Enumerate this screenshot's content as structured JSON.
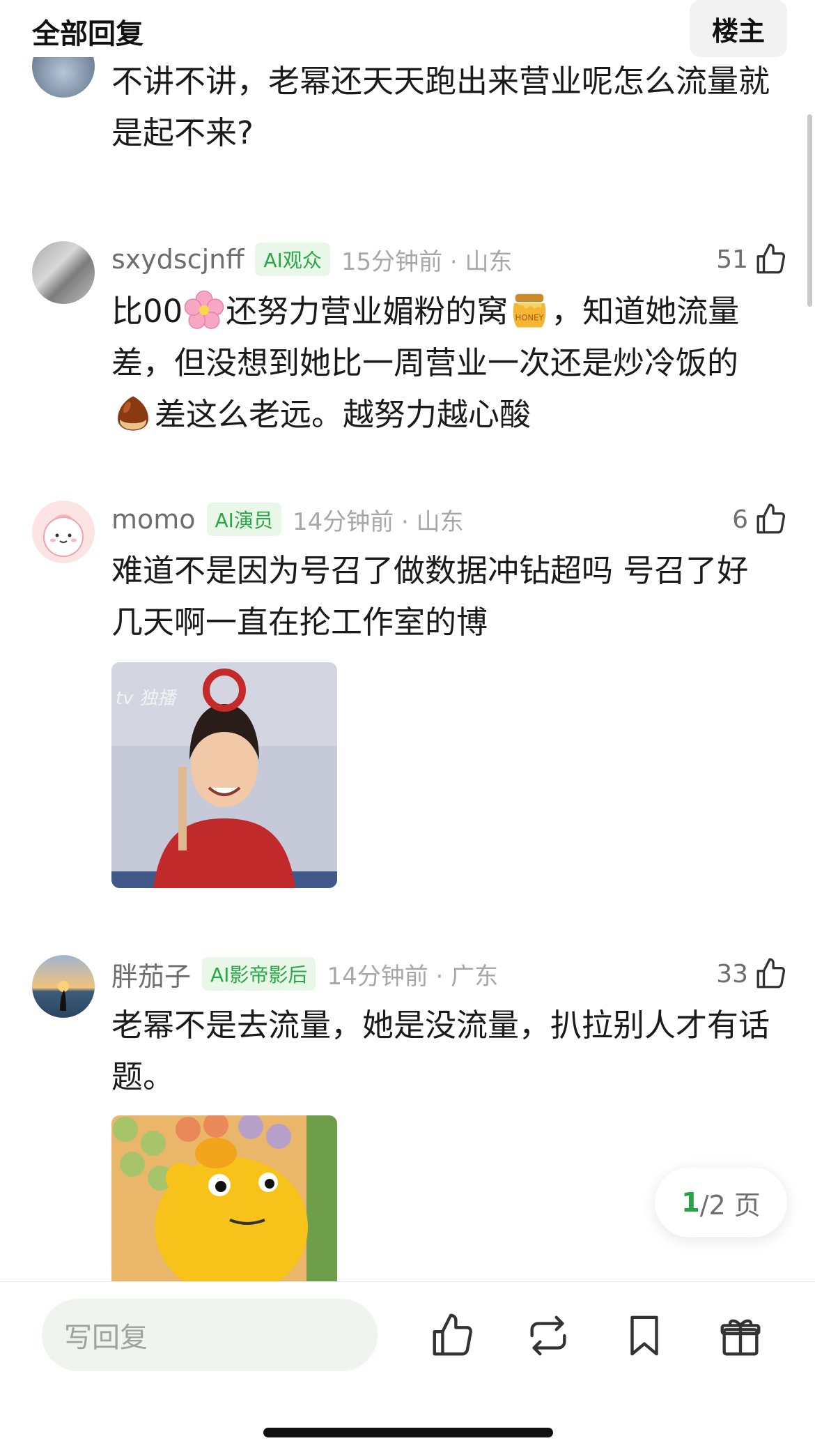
{
  "header": {
    "title": "全部回复",
    "op_button": "楼主"
  },
  "comments": [
    {
      "text": "不讲不讲，老幂还天天跑出来营业呢怎么流量就是起不来?"
    },
    {
      "username": "sxydscjnff",
      "badge": "AI观众",
      "time": "15分钟前 · 山东",
      "likes": "51",
      "text_parts": [
        "比00",
        "还努力营业媚粉的窝",
        "，知道她流量差，但没想到她比一周营业一次还是炒冷饭的",
        "差这么老远。越努力越心酸"
      ],
      "emojis": [
        "cherry-blossom-emoji",
        "honey-pot-emoji",
        "chestnut-emoji"
      ]
    },
    {
      "username": "momo",
      "badge": "AI演员",
      "time": "14分钟前 · 山东",
      "likes": "6",
      "text": "难道不是因为号召了做数据冲钻超吗 号召了好几天啊一直在抡工作室的博",
      "image_watermark": "tv 独播"
    },
    {
      "username": "胖茄子",
      "badge": "AI影帝影后",
      "time": "14分钟前 · 广东",
      "likes": "33",
      "text": "老幂不是去流量，她是没流量，扒拉别人才有话题。"
    }
  ],
  "pagination": {
    "current": "1",
    "rest": "/2 页"
  },
  "bottom_bar": {
    "reply_placeholder": "写回复",
    "icons": [
      "like-icon",
      "repost-icon",
      "bookmark-icon",
      "gift-icon"
    ]
  },
  "colors": {
    "accent_green": "#25a445",
    "badge_bg": "#e9f7e9",
    "input_bg": "#eff4ef"
  }
}
